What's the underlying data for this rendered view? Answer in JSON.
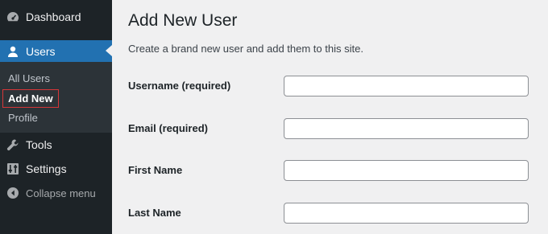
{
  "sidebar": {
    "dashboard": {
      "label": "Dashboard",
      "icon": "dashboard-icon"
    },
    "users": {
      "label": "Users",
      "icon": "user-icon"
    },
    "submenu": {
      "all_users": "All Users",
      "add_new": "Add New",
      "profile": "Profile"
    },
    "tools": {
      "label": "Tools",
      "icon": "wrench-icon"
    },
    "settings": {
      "label": "Settings",
      "icon": "settings-sliders-icon"
    },
    "collapse": {
      "label": "Collapse menu",
      "icon": "collapse-arrow-icon"
    }
  },
  "main": {
    "title": "Add New User",
    "description": "Create a brand new user and add them to this site.",
    "fields": {
      "username": {
        "label": "Username (required)",
        "value": ""
      },
      "email": {
        "label": "Email (required)",
        "value": ""
      },
      "first_name": {
        "label": "First Name",
        "value": ""
      },
      "last_name": {
        "label": "Last Name",
        "value": ""
      }
    }
  },
  "colors": {
    "sidebar_bg": "#1d2327",
    "submenu_bg": "#2c3338",
    "active_bg": "#2271b1",
    "page_bg": "#f0f0f1",
    "highlight_border": "#d63638"
  }
}
